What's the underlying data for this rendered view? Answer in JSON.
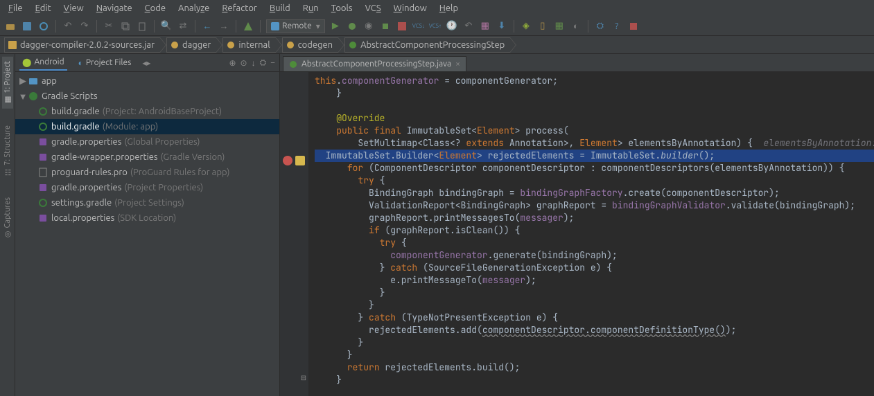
{
  "menu": {
    "items": [
      "File",
      "Edit",
      "View",
      "Navigate",
      "Code",
      "Analyze",
      "Refactor",
      "Build",
      "Run",
      "Tools",
      "VCS",
      "Window",
      "Help"
    ]
  },
  "runConfig": {
    "label": "Remote",
    "icon": "remote-icon"
  },
  "breadcrumb": [
    {
      "icon": "jar",
      "label": "dagger-compiler-2.0.2-sources.jar"
    },
    {
      "icon": "pkg",
      "label": "dagger"
    },
    {
      "icon": "pkg",
      "label": "internal"
    },
    {
      "icon": "pkg",
      "label": "codegen"
    },
    {
      "icon": "class",
      "label": "AbstractComponentProcessingStep"
    }
  ],
  "leftTabs": [
    {
      "label": "1: Project",
      "active": true
    },
    {
      "label": "7: Structure",
      "active": false
    },
    {
      "label": "Captures",
      "active": false
    }
  ],
  "projHeader": {
    "tab1": "Android",
    "tab2": "Project Files"
  },
  "tree": [
    {
      "lvl": 0,
      "tw": "▶",
      "icon": "module",
      "label": "app",
      "muted": ""
    },
    {
      "lvl": 0,
      "tw": "▼",
      "icon": "gradle",
      "label": "Gradle Scripts",
      "muted": ""
    },
    {
      "lvl": 1,
      "tw": "",
      "icon": "gradle-f",
      "label": "build.gradle",
      "muted": "(Project: AndroidBaseProject)"
    },
    {
      "lvl": 1,
      "tw": "",
      "icon": "gradle-f",
      "label": "build.gradle",
      "muted": "(Module: app)",
      "selected": true
    },
    {
      "lvl": 1,
      "tw": "",
      "icon": "prop",
      "label": "gradle.properties",
      "muted": "(Global Properties)"
    },
    {
      "lvl": 1,
      "tw": "",
      "icon": "prop",
      "label": "gradle-wrapper.properties",
      "muted": "(Gradle Version)"
    },
    {
      "lvl": 1,
      "tw": "",
      "icon": "txt",
      "label": "proguard-rules.pro",
      "muted": "(ProGuard Rules for app)"
    },
    {
      "lvl": 1,
      "tw": "",
      "icon": "prop",
      "label": "gradle.properties",
      "muted": "(Project Properties)"
    },
    {
      "lvl": 1,
      "tw": "",
      "icon": "gradle-f",
      "label": "settings.gradle",
      "muted": "(Project Settings)"
    },
    {
      "lvl": 1,
      "tw": "",
      "icon": "prop",
      "label": "local.properties",
      "muted": "(SDK Location)"
    }
  ],
  "editorTab": {
    "label": "AbstractComponentProcessingStep.java"
  },
  "code": {
    "l1": "      this.componentGenerator = componentGenerator;",
    "l2": "    }",
    "l3": "",
    "l4": "    @Override",
    "l5_a": "    public final ",
    "l5_b": "ImmutableSet",
    "l5_c": "<",
    "l5_d": "Element",
    "l5_e": "> process(",
    "l6_a": "        SetMultimap<Class<? ",
    "l6_b": "extends",
    "l6_c": " Annotation>, ",
    "l6_d": "Element",
    "l6_e": "> elementsByAnnotation) {",
    "l6_f": "  elementsByAnnotation:",
    "l7_a": "  ImmutableSet.Builder<",
    "l7_b": "Element",
    "l7_c": "> rejectedElements = ImmutableSet.",
    "l7_d": "builder",
    "l7_e": "();",
    "l8_a": "      for ",
    "l8_b": "(ComponentDescriptor componentDescriptor : componentDescriptors(elementsByAnnotation)) {",
    "l9": "        try {",
    "l10_a": "          BindingGraph bindingGraph = ",
    "l10_b": "bindingGraphFactory",
    "l10_c": ".create(componentDescriptor);",
    "l11_a": "          ValidationReport<BindingGraph> graphReport = ",
    "l11_b": "bindingGraphValidator",
    "l11_c": ".validate(bindingGraph);",
    "l12_a": "          graphReport.printMessagesTo(",
    "l12_b": "messager",
    "l12_c": ");",
    "l13_a": "          if ",
    "l13_b": "(graphReport.isClean()) {",
    "l14": "            try {",
    "l15_a": "              ",
    "l15_b": "componentGenerator",
    "l15_c": ".generate(bindingGraph);",
    "l16_a": "            } ",
    "l16_b": "catch ",
    "l16_c": "(SourceFileGenerationException e) {",
    "l17_a": "              e.printMessageTo(",
    "l17_b": "messager",
    "l17_c": ");",
    "l18": "            }",
    "l19": "          }",
    "l20_a": "        } ",
    "l20_b": "catch ",
    "l20_c": "(TypeNotPresentException e) {",
    "l21_a": "          rejectedElements.add(",
    "l21_b": "componentDescriptor.componentDefinitionType()",
    "l21_c": ");",
    "l22": "        }",
    "l23": "      }",
    "l24_a": "      return ",
    "l24_b": "rejectedElements.build();",
    "l25": "    }"
  }
}
